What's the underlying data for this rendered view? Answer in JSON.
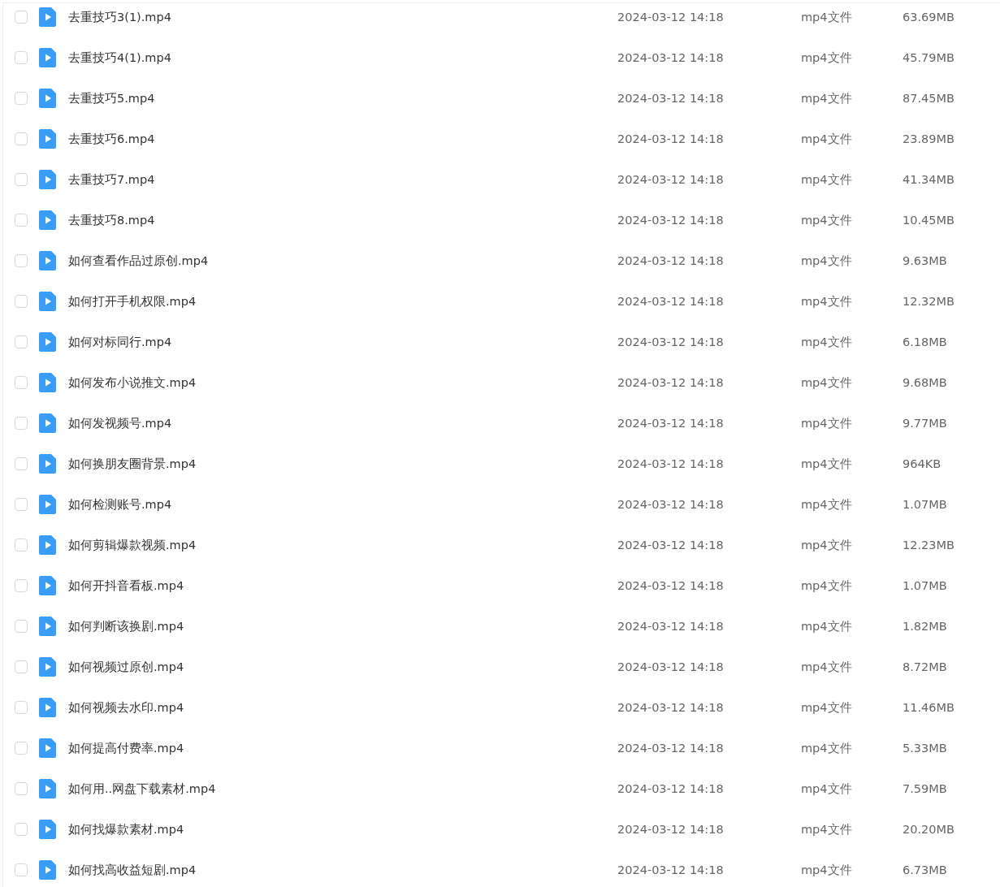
{
  "files": [
    {
      "name": "去重技巧3(1).mp4",
      "modified": "2024-03-12 14:18",
      "type": "mp4文件",
      "size": "63.69MB",
      "checked": false
    },
    {
      "name": "去重技巧4(1).mp4",
      "modified": "2024-03-12 14:18",
      "type": "mp4文件",
      "size": "45.79MB",
      "checked": false
    },
    {
      "name": "去重技巧5.mp4",
      "modified": "2024-03-12 14:18",
      "type": "mp4文件",
      "size": "87.45MB",
      "checked": false
    },
    {
      "name": "去重技巧6.mp4",
      "modified": "2024-03-12 14:18",
      "type": "mp4文件",
      "size": "23.89MB",
      "checked": false
    },
    {
      "name": "去重技巧7.mp4",
      "modified": "2024-03-12 14:18",
      "type": "mp4文件",
      "size": "41.34MB",
      "checked": false
    },
    {
      "name": "去重技巧8.mp4",
      "modified": "2024-03-12 14:18",
      "type": "mp4文件",
      "size": "10.45MB",
      "checked": false
    },
    {
      "name": "如何查看作品过原创.mp4",
      "modified": "2024-03-12 14:18",
      "type": "mp4文件",
      "size": "9.63MB",
      "checked": false
    },
    {
      "name": "如何打开手机权限.mp4",
      "modified": "2024-03-12 14:18",
      "type": "mp4文件",
      "size": "12.32MB",
      "checked": false
    },
    {
      "name": "如何对标同行.mp4",
      "modified": "2024-03-12 14:18",
      "type": "mp4文件",
      "size": "6.18MB",
      "checked": false
    },
    {
      "name": "如何发布小说推文.mp4",
      "modified": "2024-03-12 14:18",
      "type": "mp4文件",
      "size": "9.68MB",
      "checked": false
    },
    {
      "name": "如何发视频号.mp4",
      "modified": "2024-03-12 14:18",
      "type": "mp4文件",
      "size": "9.77MB",
      "checked": false
    },
    {
      "name": "如何换朋友圈背景.mp4",
      "modified": "2024-03-12 14:18",
      "type": "mp4文件",
      "size": "964KB",
      "checked": false
    },
    {
      "name": "如何检测账号.mp4",
      "modified": "2024-03-12 14:18",
      "type": "mp4文件",
      "size": "1.07MB",
      "checked": false
    },
    {
      "name": "如何剪辑爆款视频.mp4",
      "modified": "2024-03-12 14:18",
      "type": "mp4文件",
      "size": "12.23MB",
      "checked": false
    },
    {
      "name": "如何开抖音看板.mp4",
      "modified": "2024-03-12 14:18",
      "type": "mp4文件",
      "size": "1.07MB",
      "checked": false
    },
    {
      "name": "如何判断该换剧.mp4",
      "modified": "2024-03-12 14:18",
      "type": "mp4文件",
      "size": "1.82MB",
      "checked": false
    },
    {
      "name": "如何视频过原创.mp4",
      "modified": "2024-03-12 14:18",
      "type": "mp4文件",
      "size": "8.72MB",
      "checked": false
    },
    {
      "name": "如何视频去水印.mp4",
      "modified": "2024-03-12 14:18",
      "type": "mp4文件",
      "size": "11.46MB",
      "checked": false
    },
    {
      "name": "如何提高付费率.mp4",
      "modified": "2024-03-12 14:18",
      "type": "mp4文件",
      "size": "5.33MB",
      "checked": false
    },
    {
      "name": "如何用..网盘下载素材.mp4",
      "modified": "2024-03-12 14:18",
      "type": "mp4文件",
      "size": "7.59MB",
      "checked": false
    },
    {
      "name": "如何找爆款素材.mp4",
      "modified": "2024-03-12 14:18",
      "type": "mp4文件",
      "size": "20.20MB",
      "checked": false
    },
    {
      "name": "如何找高收益短剧.mp4",
      "modified": "2024-03-12 14:18",
      "type": "mp4文件",
      "size": "6.73MB",
      "checked": false
    }
  ]
}
